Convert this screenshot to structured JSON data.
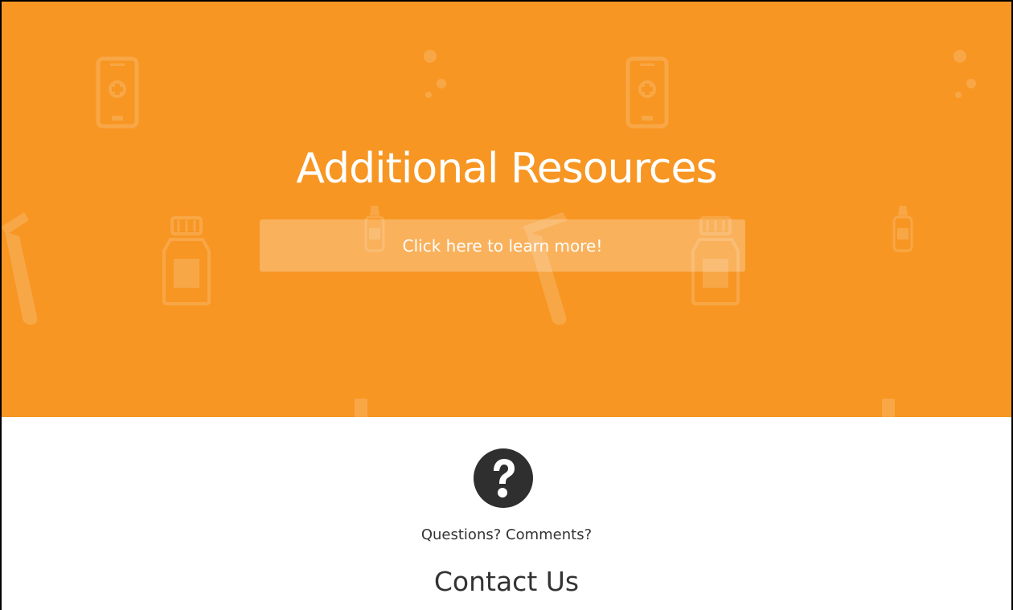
{
  "hero": {
    "title": "Additional Resources",
    "button_label": "Click here to learn more!",
    "background_color": "#f79623",
    "background_pattern_icons": [
      "phone-icon",
      "pill-bottle-icon",
      "dropper-bottle-icon",
      "test-tube-icon",
      "otoscope-icon"
    ]
  },
  "contact": {
    "icon": "question-circle-icon",
    "subtitle": "Questions? Comments?",
    "heading": "Contact Us",
    "text_color": "#333333"
  }
}
